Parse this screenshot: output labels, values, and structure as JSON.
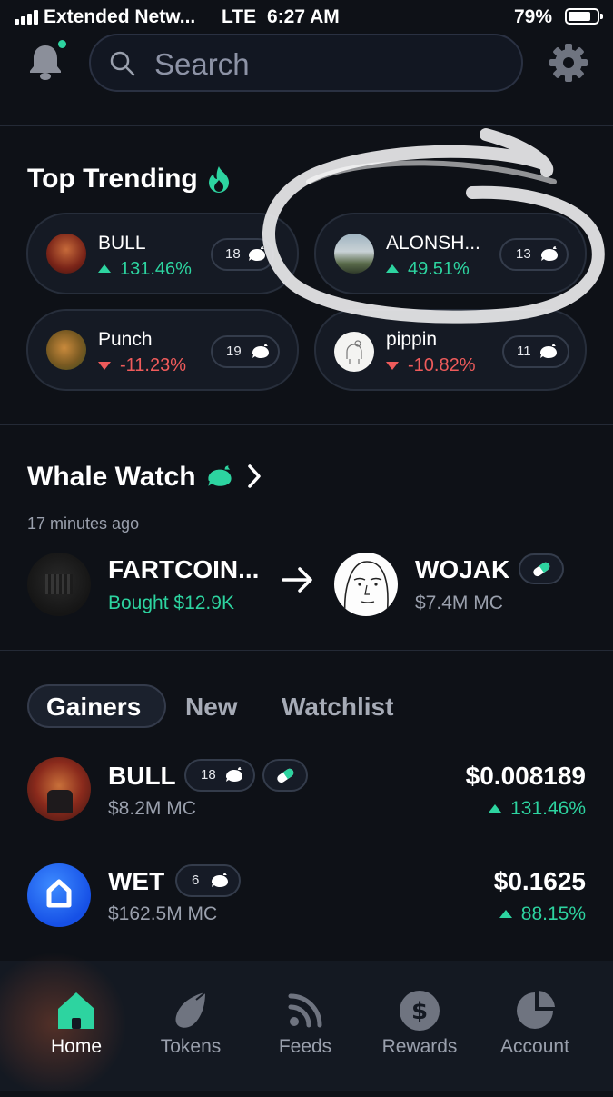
{
  "status_bar": {
    "carrier": "Extended Netw...",
    "network": "LTE",
    "time": "6:27 AM",
    "battery": "79%",
    "battery_level": 0.79
  },
  "header": {
    "search_placeholder": "Search"
  },
  "top_trending": {
    "title": "Top Trending",
    "items": [
      {
        "name": "BULL",
        "change": "131.46%",
        "direction": "up",
        "whales": "18"
      },
      {
        "name": "ALONSH...",
        "change": "49.51%",
        "direction": "up",
        "whales": "13"
      },
      {
        "name": "Punch",
        "change": "-11.23%",
        "direction": "down",
        "whales": "19"
      },
      {
        "name": "pippin",
        "change": "-10.82%",
        "direction": "down",
        "whales": "11"
      }
    ]
  },
  "whale_watch": {
    "title": "Whale Watch",
    "time_ago": "17 minutes ago",
    "from_token": "FARTCOIN...",
    "action": "Bought $12.9K",
    "to_token": "WOJAK",
    "to_mc": "$7.4M MC"
  },
  "tabs": {
    "items": [
      "Gainers",
      "New",
      "Watchlist"
    ],
    "active": "Gainers"
  },
  "gainers": [
    {
      "name": "BULL",
      "whales": "18",
      "market_cap": "$8.2M MC",
      "price": "$0.008189",
      "change": "131.46%"
    },
    {
      "name": "WET",
      "whales": "6",
      "market_cap": "$162.5M MC",
      "price": "$0.1625",
      "change": "88.15%"
    }
  ],
  "bottom_nav": {
    "items": [
      "Home",
      "Tokens",
      "Feeds",
      "Rewards",
      "Account"
    ],
    "active": "Home"
  },
  "colors": {
    "background": "#0e1117",
    "accent_green": "#2dd4a0",
    "negative_red": "#ef5b5b"
  },
  "icons": {
    "bell": "bell-icon",
    "search": "search-icon",
    "settings": "gear-icon",
    "trending": "flame-icon",
    "whale": "whale-icon",
    "pill": "pill-icon",
    "arrow": "arrow-right-icon"
  }
}
